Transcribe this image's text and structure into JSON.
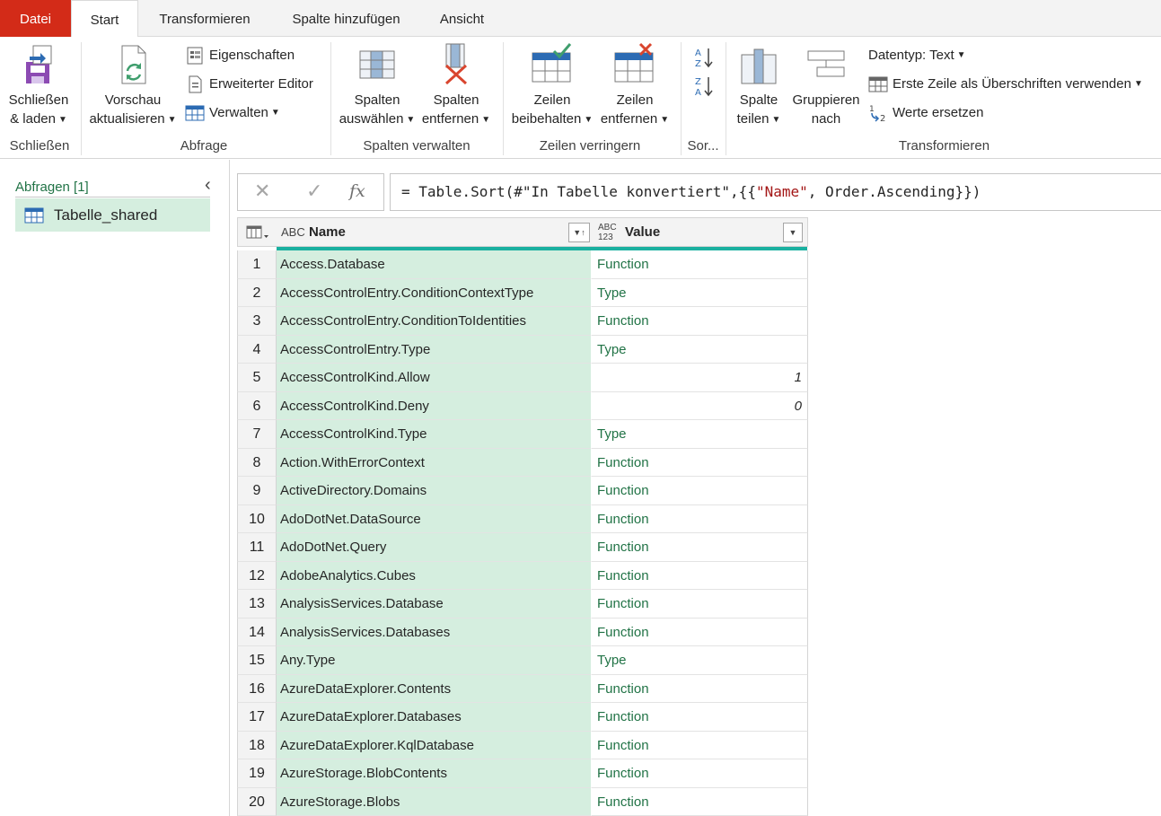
{
  "tabs": {
    "file": "Datei",
    "home": "Start",
    "transform": "Transformieren",
    "add_column": "Spalte hinzufügen",
    "view": "Ansicht"
  },
  "ribbon": {
    "close_group": {
      "label": "Schließen",
      "close_load_line1": "Schließen",
      "close_load_line2": "& laden"
    },
    "query_group": {
      "label": "Abfrage",
      "refresh_line1": "Vorschau",
      "refresh_line2": "aktualisieren",
      "properties": "Eigenschaften",
      "advanced_editor": "Erweiterter Editor",
      "manage": "Verwalten"
    },
    "columns_group": {
      "label": "Spalten verwalten",
      "choose_line1": "Spalten",
      "choose_line2": "auswählen",
      "remove_line1": "Spalten",
      "remove_line2": "entfernen"
    },
    "rows_group": {
      "label": "Zeilen verringern",
      "keep_line1": "Zeilen",
      "keep_line2": "beibehalten",
      "remove_line1": "Zeilen",
      "remove_line2": "entfernen"
    },
    "sort_group": {
      "label": "Sor..."
    },
    "transform_group": {
      "label": "Transformieren",
      "split_line1": "Spalte",
      "split_line2": "teilen",
      "group_line1": "Gruppieren",
      "group_line2": "nach",
      "datatype": "Datentyp: Text",
      "first_row_headers": "Erste Zeile als Überschriften verwenden",
      "replace_values": "Werte ersetzen"
    }
  },
  "queries": {
    "header": "Abfragen [1]",
    "items": [
      {
        "label": "Tabelle_shared"
      }
    ]
  },
  "formula": {
    "prefix": "= Table.Sort(#\"In Tabelle konvertiert\",{{",
    "string": "\"Name\"",
    "suffix": ", Order.Ascending}})"
  },
  "grid": {
    "columns": [
      {
        "type_icon": "ABC",
        "label": "Name"
      },
      {
        "type_icon": "ABC 123",
        "label": "Value"
      }
    ],
    "rows": [
      {
        "num": "1",
        "name": "Access.Database",
        "value": "Function"
      },
      {
        "num": "2",
        "name": "AccessControlEntry.ConditionContextType",
        "value": "Type"
      },
      {
        "num": "3",
        "name": "AccessControlEntry.ConditionToIdentities",
        "value": "Function"
      },
      {
        "num": "4",
        "name": "AccessControlEntry.Type",
        "value": "Type"
      },
      {
        "num": "5",
        "name": "AccessControlKind.Allow",
        "value": "1"
      },
      {
        "num": "6",
        "name": "AccessControlKind.Deny",
        "value": "0"
      },
      {
        "num": "7",
        "name": "AccessControlKind.Type",
        "value": "Type"
      },
      {
        "num": "8",
        "name": "Action.WithErrorContext",
        "value": "Function"
      },
      {
        "num": "9",
        "name": "ActiveDirectory.Domains",
        "value": "Function"
      },
      {
        "num": "10",
        "name": "AdoDotNet.DataSource",
        "value": "Function"
      },
      {
        "num": "11",
        "name": "AdoDotNet.Query",
        "value": "Function"
      },
      {
        "num": "12",
        "name": "AdobeAnalytics.Cubes",
        "value": "Function"
      },
      {
        "num": "13",
        "name": "AnalysisServices.Database",
        "value": "Function"
      },
      {
        "num": "14",
        "name": "AnalysisServices.Databases",
        "value": "Function"
      },
      {
        "num": "15",
        "name": "Any.Type",
        "value": "Type"
      },
      {
        "num": "16",
        "name": "AzureDataExplorer.Contents",
        "value": "Function"
      },
      {
        "num": "17",
        "name": "AzureDataExplorer.Databases",
        "value": "Function"
      },
      {
        "num": "18",
        "name": "AzureDataExplorer.KqlDatabase",
        "value": "Function"
      },
      {
        "num": "19",
        "name": "AzureStorage.BlobContents",
        "value": "Function"
      },
      {
        "num": "20",
        "name": "AzureStorage.Blobs",
        "value": "Function"
      }
    ]
  },
  "colors": {
    "file_tab": "#d32b18",
    "accent_green": "#217346",
    "selected_column": "#d5eedf",
    "quality_bar": "#1ab0a0"
  }
}
